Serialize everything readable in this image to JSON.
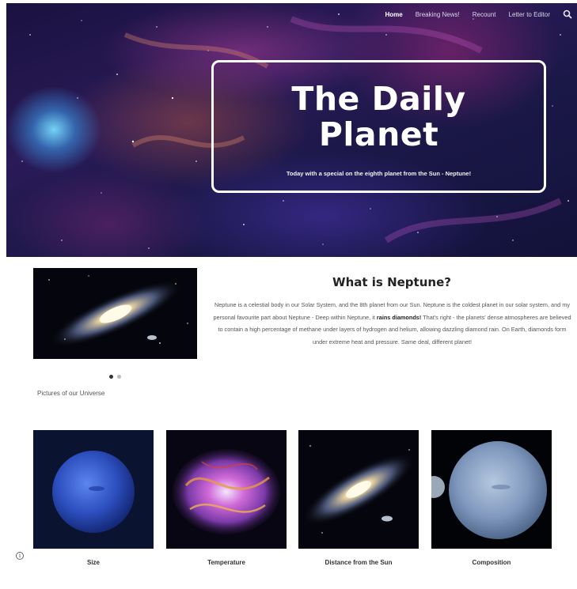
{
  "nav": {
    "items": [
      {
        "label": "Home",
        "active": true
      },
      {
        "label": "Breaking News!",
        "active": false
      },
      {
        "label": "Recount",
        "active": false
      },
      {
        "label": "Letter to Editor",
        "active": false
      }
    ],
    "search_icon": "search-icon"
  },
  "hero": {
    "title_line1": "The Daily",
    "title_line2": "Planet",
    "subtitle": "Today with a special on the eighth planet from the Sun - Neptune!"
  },
  "carousel": {
    "caption": "Pictures of our Universe",
    "slide_count": 2,
    "active_slide": 1
  },
  "neptune": {
    "heading": "What is Neptune?",
    "body_before": "Neptune is a celestial body in our Solar System, and the 8th planet from our Sun. Neptune is the coldest planet in our solar system, and my personal favourite part about Neptune - Deep within Neptune, it ",
    "body_bold": "rains diamonds!",
    "body_after": " That's right - the planets' dense atmospheres are believed to contain a high percentage of methane under layers of hydrogen and helium, allowing dazzling diamond rain. On Earth, diamonds form under extreme heat and pressure. Same deal, different planet!"
  },
  "cards": [
    {
      "label": "Size"
    },
    {
      "label": "Temperature"
    },
    {
      "label": "Distance from the Sun"
    },
    {
      "label": "Composition"
    }
  ],
  "colors": {
    "hero_bg": "#1a1240",
    "title_border": "#ffffff",
    "neptune_blue": "#3a62d6",
    "uranus_blue": "#8fa8c8"
  }
}
